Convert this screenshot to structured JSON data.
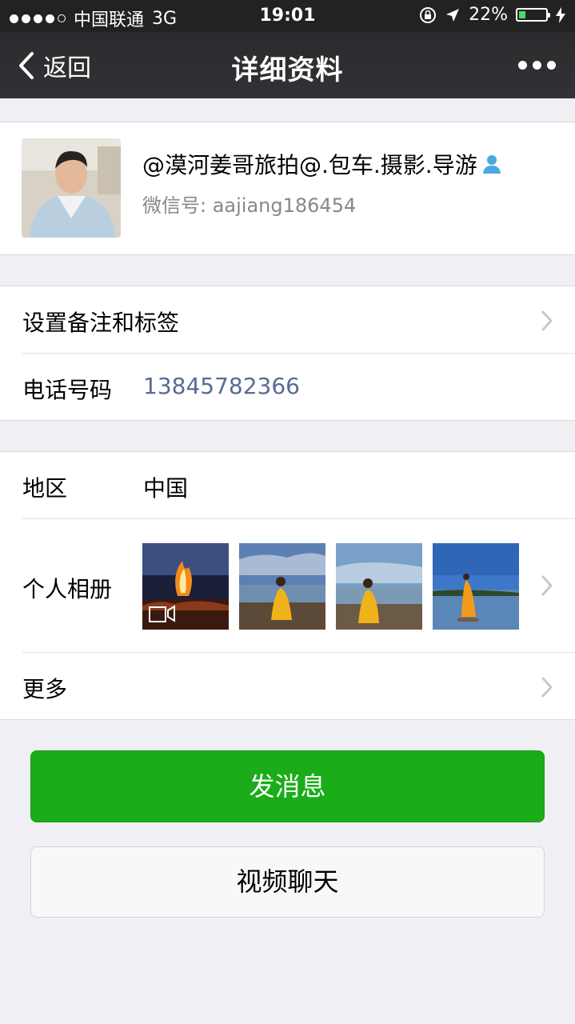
{
  "status_bar": {
    "carrier": "中国联通",
    "network": "3G",
    "time": "19:01",
    "battery": "22%"
  },
  "nav": {
    "back_label": "返回",
    "title": "详细资料"
  },
  "profile": {
    "name": "@漠河姜哥旅拍@.包车.摄影.导游",
    "wechat_id_label": "微信号: ",
    "wechat_id": "aajiang186454"
  },
  "settings": {
    "remark_label": "设置备注和标签",
    "phone_label": "电话号码",
    "phone_value": "13845782366"
  },
  "info": {
    "region_label": "地区",
    "region_value": "中国",
    "album_label": "个人相册",
    "more_label": "更多"
  },
  "buttons": {
    "send_message": "发消息",
    "video_chat": "视频聊天"
  },
  "colors": {
    "accent_green": "#1aad19",
    "link_blue": "#576b95"
  }
}
